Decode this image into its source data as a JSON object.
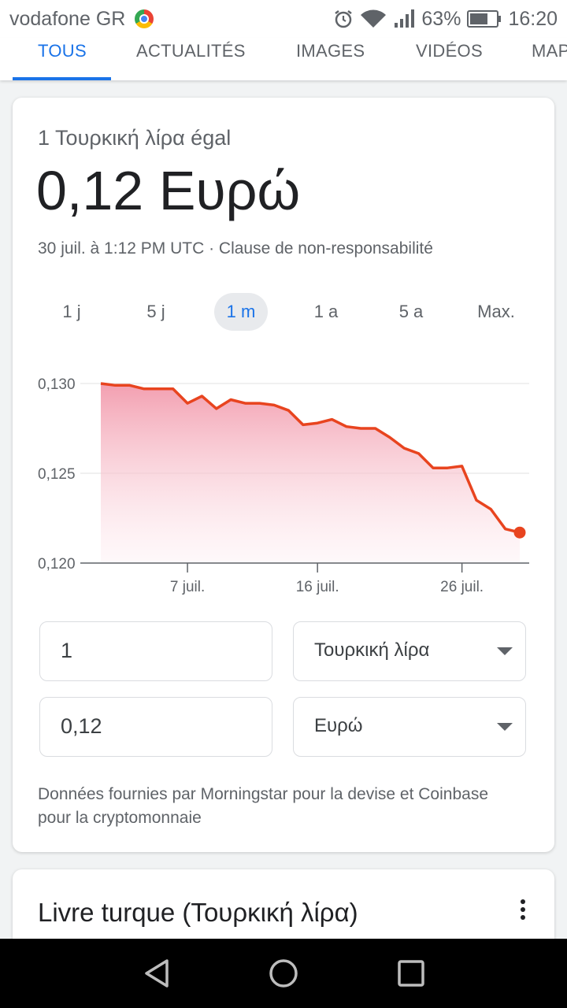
{
  "status": {
    "carrier": "vodafone GR",
    "battery": "63%",
    "time": "16:20"
  },
  "tabs": [
    {
      "label": "TOUS",
      "active": true
    },
    {
      "label": "ACTUALITÉS",
      "active": false
    },
    {
      "label": "IMAGES",
      "active": false
    },
    {
      "label": "VIDÉOS",
      "active": false
    },
    {
      "label": "MAPS",
      "active": false
    }
  ],
  "converter": {
    "subtitle": "1 Τουρκική λίρα égal",
    "value": "0,12 Ευρώ",
    "meta": "30 juil. à 1:12 PM UTC · Clause de non-responsabilité",
    "ranges": [
      {
        "label": "1 j",
        "active": false
      },
      {
        "label": "5 j",
        "active": false
      },
      {
        "label": "1 m",
        "active": true
      },
      {
        "label": "1 a",
        "active": false
      },
      {
        "label": "5 a",
        "active": false
      },
      {
        "label": "Max.",
        "active": false
      }
    ],
    "amount_from": "1",
    "currency_from": "Τουρκική λίρα",
    "amount_to": "0,12",
    "currency_to": "Ευρώ",
    "source": "Données fournies par Morningstar pour la devise et Coinbase pour la cryptomonnaie"
  },
  "chart_data": {
    "type": "area",
    "ylim": [
      0.12,
      0.13
    ],
    "yticks": [
      "0,130",
      "0,125",
      "0,120"
    ],
    "xticks": [
      {
        "label": "7 juil.",
        "day": 7
      },
      {
        "label": "16 juil.",
        "day": 16
      },
      {
        "label": "26 juil.",
        "day": 26
      }
    ],
    "x": [
      1,
      2,
      3,
      4,
      5,
      6,
      7,
      8,
      9,
      10,
      11,
      12,
      13,
      14,
      15,
      16,
      17,
      18,
      19,
      20,
      21,
      22,
      23,
      24,
      25,
      26,
      27,
      28,
      29,
      30
    ],
    "values": [
      0.13,
      0.1299,
      0.1299,
      0.1297,
      0.1297,
      0.1297,
      0.1289,
      0.1293,
      0.1286,
      0.1291,
      0.1289,
      0.1289,
      0.1288,
      0.1285,
      0.1277,
      0.1278,
      0.128,
      0.1276,
      0.1275,
      0.1275,
      0.127,
      0.1264,
      0.1261,
      0.1253,
      0.1253,
      0.1254,
      0.1235,
      0.123,
      0.1219,
      0.1217
    ],
    "color": "#e8441f"
  },
  "related": {
    "title": "Livre turque (Τουρκική λίρα)"
  }
}
